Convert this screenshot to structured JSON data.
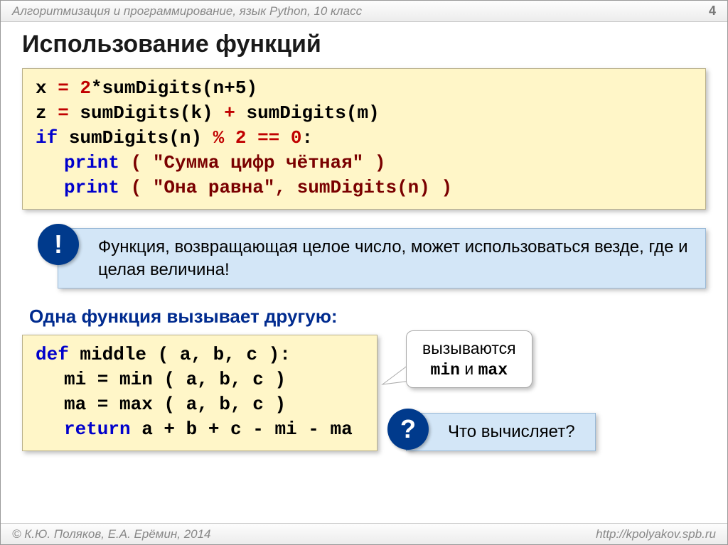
{
  "header": {
    "left": "Алгоритмизация и программирование, язык Python, 10 класс",
    "pageNumber": "4"
  },
  "title": "Использование функций",
  "code1": {
    "l1a": "x",
    "l1eq": " = ",
    "l1num": "2",
    "l1b": "*sumDigits(n+5)",
    "l2a": "z",
    "l2eq": " = ",
    "l2b": "sumDigits(k)",
    "l2plus": " + ",
    "l2c": "sumDigits(m)",
    "l3a": "if ",
    "l3b": "sumDigits(n)",
    "l3mod": " % ",
    "l3two": "2",
    "l3eqeq": " == ",
    "l3zero": "0",
    "l3colon": ":",
    "l4kw": "print",
    "l4rest": " ( \"Сумма цифр чётная\" )",
    "l5kw": "print",
    "l5rest": " ( \"Она равна\", sumDigits(n) )"
  },
  "note": {
    "badge": "!",
    "text": "Функция, возвращающая целое число, может использоваться везде, где и целая величина!"
  },
  "subhead": "Одна функция вызывает другую:",
  "code2": {
    "l1kw": "def ",
    "l1b": "middle",
    "l1c": " ( a, b, c ):",
    "l2": "mi = min ( a, b, c )",
    "l3": "ma = max ( a, b, c )",
    "l4kw": "return ",
    "l4rest": "a + b + c - mi - ma"
  },
  "bubble": {
    "line1": "вызываются",
    "line2a": "min",
    "line2and": " и ",
    "line2b": "max"
  },
  "question": {
    "badge": "?",
    "text": "Что вычисляет?"
  },
  "footer": {
    "left": "© К.Ю. Поляков, Е.А. Ерёмин, 2014",
    "right": "http://kpolyakov.spb.ru"
  }
}
